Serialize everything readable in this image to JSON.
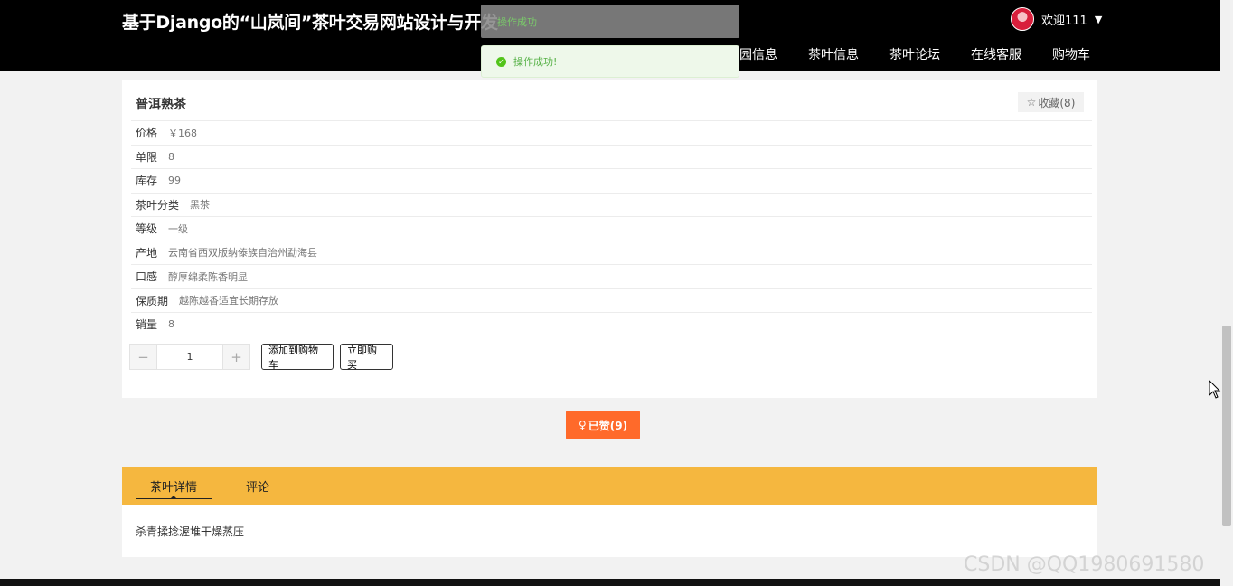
{
  "header": {
    "site_title": "基于Django的“山岚间”茶叶交易网站设计与开发",
    "user_label": "欢迎111",
    "caret": "▼",
    "nav": [
      "园信息",
      "茶叶信息",
      "茶叶论坛",
      "在线客服",
      "购物车"
    ]
  },
  "toasts": {
    "dark_text": "操作成功",
    "light_text": "操作成功!"
  },
  "product": {
    "name": "普洱熟茶",
    "favorite_label": "收藏(8)",
    "attributes": [
      {
        "label": "价格",
        "value": "￥168"
      },
      {
        "label": "单限",
        "value": "8"
      },
      {
        "label": "库存",
        "value": "99"
      },
      {
        "label": "茶叶分类",
        "value": "黑茶"
      },
      {
        "label": "等级",
        "value": "一级"
      },
      {
        "label": "产地",
        "value": "云南省西双版纳傣族自治州勐海县"
      },
      {
        "label": "口感",
        "value": "醇厚绵柔陈香明显"
      },
      {
        "label": "保质期",
        "value": "越陈越香适宜长期存放"
      },
      {
        "label": "销量",
        "value": "8"
      }
    ],
    "quantity": {
      "minus": "−",
      "value": "1",
      "plus": "+"
    },
    "add_to_cart": "添加到购物车",
    "buy_now": "立即购买"
  },
  "like_label": "已赞(9)",
  "tabs": {
    "detail": "茶叶详情",
    "comment": "评论",
    "detail_content": "杀青揉捻渥堆干燥蒸压"
  },
  "watermark": "CSDN @QQ1980691580"
}
